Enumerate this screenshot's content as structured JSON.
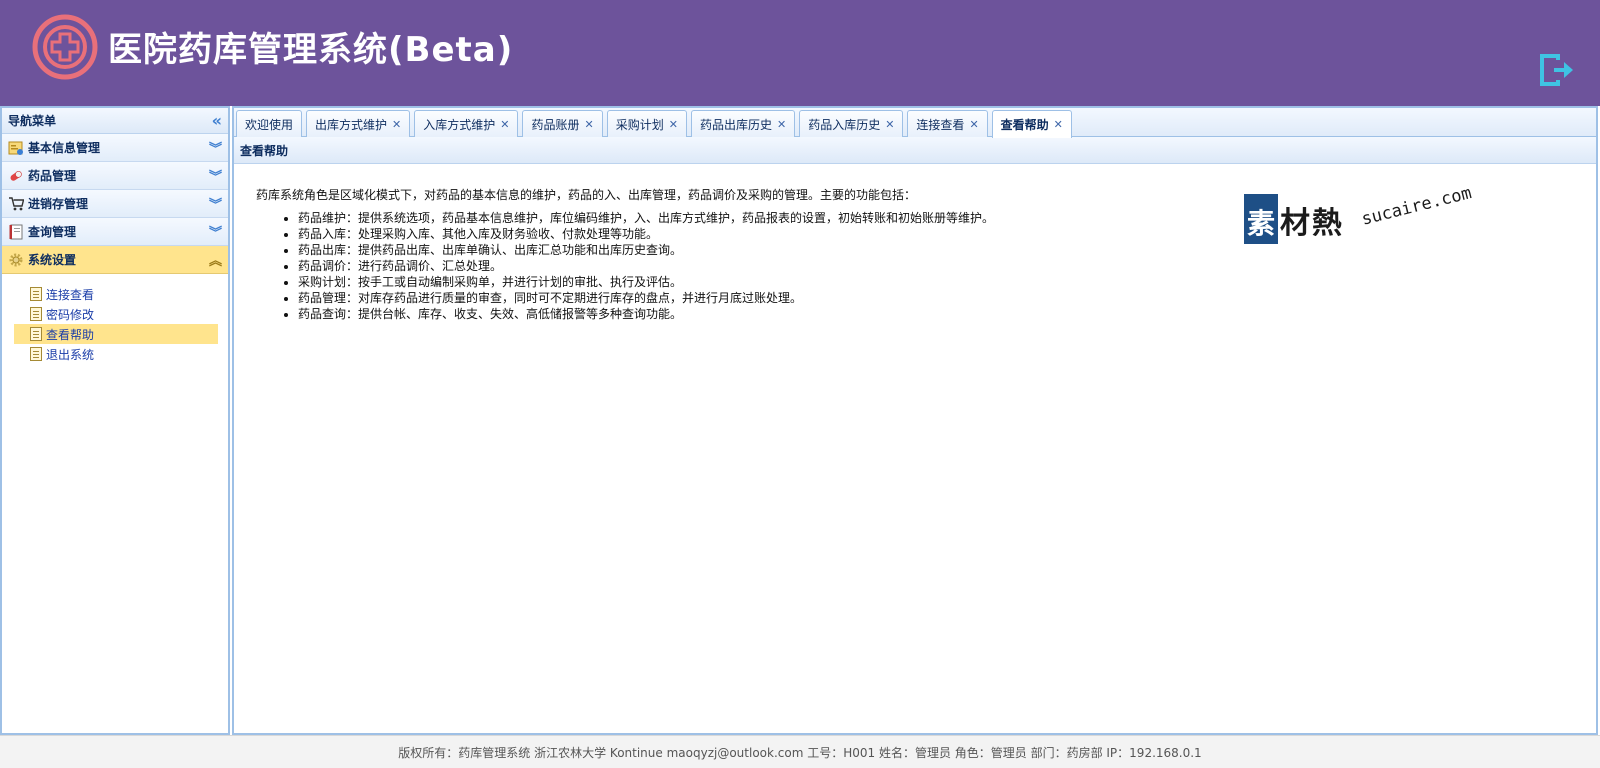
{
  "header": {
    "title": "医院药库管理系统(Beta)",
    "logo_icon": "medical-cross-icon",
    "logout_icon": "logout-icon"
  },
  "colors": {
    "header_bg": "#6d539b",
    "accent_blue": "#9ec0e6",
    "active_yellow": "#ffe48d"
  },
  "sidebar": {
    "title": "导航菜单",
    "groups": [
      {
        "label": "基本信息管理",
        "icon": "info-card-icon"
      },
      {
        "label": "药品管理",
        "icon": "pill-icon"
      },
      {
        "label": "进销存管理",
        "icon": "cart-icon"
      },
      {
        "label": "查询管理",
        "icon": "notebook-icon"
      },
      {
        "label": "系统设置",
        "icon": "gear-icon"
      }
    ],
    "sub_items": [
      {
        "label": "连接查看"
      },
      {
        "label": "密码修改"
      },
      {
        "label": "查看帮助"
      },
      {
        "label": "退出系统"
      }
    ]
  },
  "tabs": [
    {
      "label": "欢迎使用"
    },
    {
      "label": "出库方式维护"
    },
    {
      "label": "入库方式维护"
    },
    {
      "label": "药品账册"
    },
    {
      "label": "采购计划"
    },
    {
      "label": "药品出库历史"
    },
    {
      "label": "药品入库历史"
    },
    {
      "label": "连接查看"
    },
    {
      "label": "查看帮助"
    }
  ],
  "panel": {
    "title": "查看帮助",
    "intro": "药库系统角色是区域化模式下，对药品的基本信息的维护，药品的入、出库管理，药品调价及采购的管理。主要的功能包括：",
    "features": [
      "药品维护：提供系统选项，药品基本信息维护，库位编码维护，入、出库方式维护，药品报表的设置，初始转账和初始账册等维护。",
      "药品入库：处理采购入库、其他入库及财务验收、付款处理等功能。",
      "药品出库：提供药品出库、出库单确认、出库汇总功能和出库历史查询。",
      "药品调价：进行药品调价、汇总处理。",
      "采购计划：按手工或自动编制采购单，并进行计划的审批、执行及评估。",
      "药品管理：对库存药品进行质量的审查，同时可不定期进行库存的盘点，并进行月底过账处理。",
      "药品查询：提供台帐、库存、收支、失效、高低储报警等多种查询功能。"
    ]
  },
  "watermark": {
    "box_char": "素",
    "cn": "材熱",
    "en": "sucaire.com"
  },
  "footer": {
    "text": "版权所有：药库管理系统 浙江农林大学 Kontinue maoqyzj@outlook.com 工号：H001 姓名：管理员 角色：管理员 部门：药房部 IP：192.168.0.1"
  }
}
